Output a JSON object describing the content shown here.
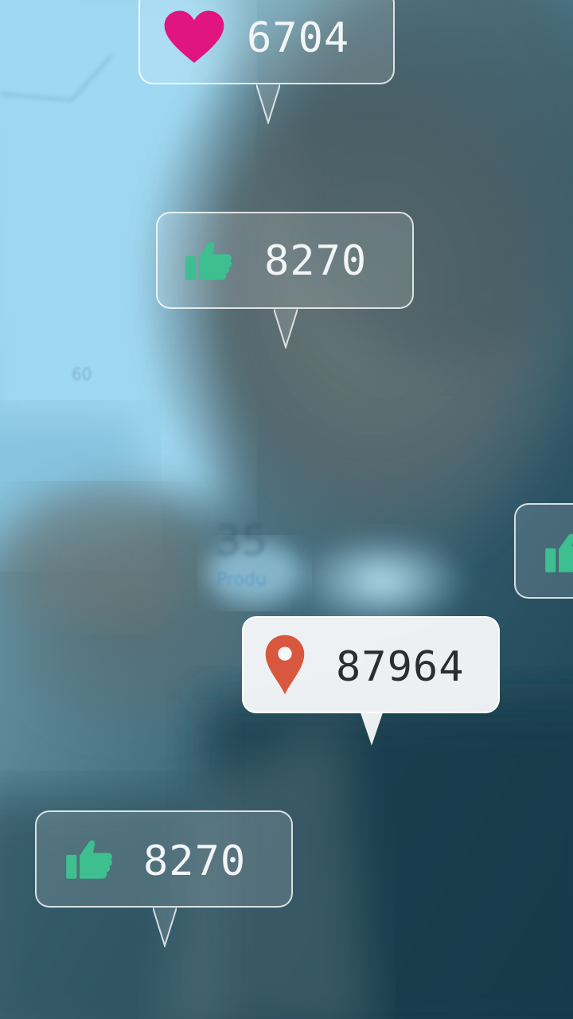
{
  "notifications": [
    {
      "icon": "heart-icon",
      "icon_color": "#e0157f",
      "count": "6704"
    },
    {
      "icon": "thumbs-up-icon",
      "icon_color": "#3dbf8f",
      "count": "8270"
    },
    {
      "icon": "thumbs-up-icon",
      "icon_color": "#3dbf8f",
      "count": ""
    },
    {
      "icon": "map-pin-icon",
      "icon_color": "#d9573e",
      "count": "87964"
    },
    {
      "icon": "thumbs-up-icon",
      "icon_color": "#3dbf8f",
      "count": "8270"
    }
  ],
  "background": {
    "ghost_label": "Produ",
    "ghost_number": "35",
    "ghost_axis": "60"
  }
}
